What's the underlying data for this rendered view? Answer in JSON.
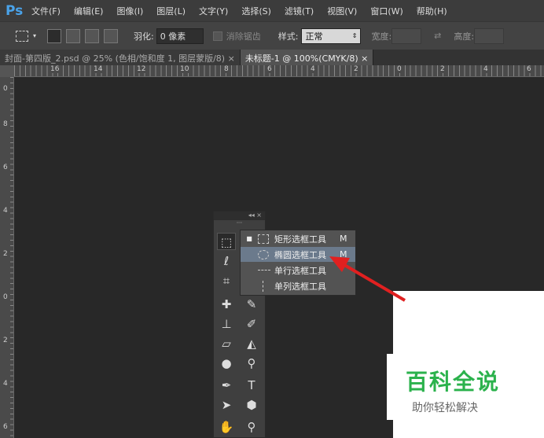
{
  "app": {
    "logo": "Ps"
  },
  "menu": [
    "文件(F)",
    "编辑(E)",
    "图像(I)",
    "图层(L)",
    "文字(Y)",
    "选择(S)",
    "滤镜(T)",
    "视图(V)",
    "窗口(W)",
    "帮助(H)"
  ],
  "options": {
    "feather_label": "羽化:",
    "feather_value": "0 像素",
    "antialias_label": "消除锯齿",
    "style_label": "样式:",
    "style_value": "正常",
    "width_label": "宽度:",
    "height_label": "高度:"
  },
  "tabs": [
    {
      "label": "封面-第四版_2.psd @ 25% (色相/饱和度 1, 图层蒙版/8)",
      "close": "×"
    },
    {
      "label": "未标题-1 @ 100%(CMYK/8)",
      "close": "×"
    }
  ],
  "hruler": [
    "16",
    "14",
    "12",
    "10",
    "8",
    "6",
    "4",
    "2",
    "0",
    "2",
    "4",
    "6"
  ],
  "vruler": [
    "0",
    "8",
    "6",
    "4",
    "2",
    "0",
    "2",
    "4",
    "6"
  ],
  "toolbox": {
    "header": "◂◂ ×"
  },
  "flyout": [
    {
      "icon": "rect-marquee-icon",
      "label": "矩形选框工具",
      "key": "M",
      "active": true
    },
    {
      "icon": "ellipse-marquee-icon",
      "label": "椭圆选框工具",
      "key": "M",
      "highlight": true
    },
    {
      "icon": "row-marquee-icon",
      "label": "单行选框工具",
      "key": ""
    },
    {
      "icon": "column-marquee-icon",
      "label": "单列选框工具",
      "key": ""
    }
  ],
  "watermark": {
    "title": "百科全说",
    "subtitle": "助你轻松解决"
  }
}
